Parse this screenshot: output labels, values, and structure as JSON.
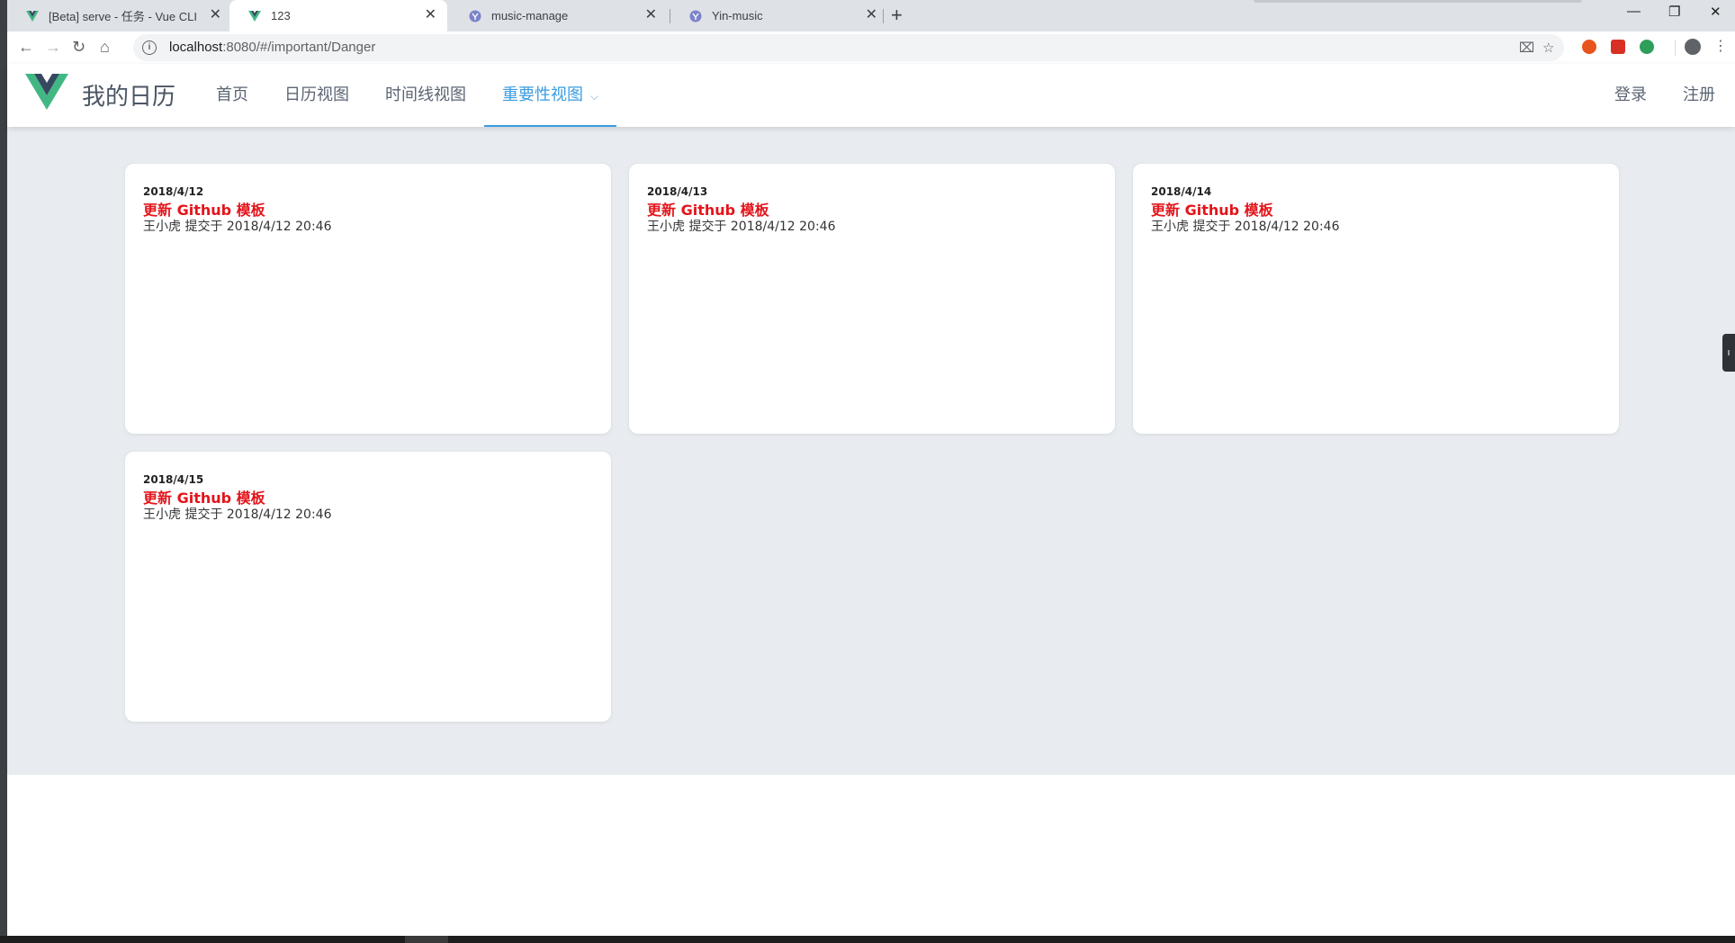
{
  "browser": {
    "tabs": [
      {
        "title": "[Beta] serve - 任务 - Vue CLI",
        "icon": "vue-icon",
        "active": false
      },
      {
        "title": "123",
        "icon": "vue-icon",
        "active": true
      },
      {
        "title": "music-manage",
        "icon": "yin-icon",
        "active": false
      },
      {
        "title": "Yin-music",
        "icon": "yin-icon",
        "active": false
      }
    ],
    "url_host": "localhost",
    "url_path": ":8080/#/important/Danger"
  },
  "app": {
    "brand": "我的日历",
    "nav": [
      {
        "label": "首页",
        "active": false
      },
      {
        "label": "日历视图",
        "active": false
      },
      {
        "label": "时间线视图",
        "active": false
      },
      {
        "label": "重要性视图",
        "active": true
      }
    ],
    "auth": {
      "login": "登录",
      "register": "注册"
    }
  },
  "cards": [
    {
      "date": "2018/4/12",
      "title": "更新 Github 模板",
      "meta": "王小虎 提交于 2018/4/12 20:46"
    },
    {
      "date": "2018/4/13",
      "title": "更新 Github 模板",
      "meta": "王小虎 提交于 2018/4/12 20:46"
    },
    {
      "date": "2018/4/14",
      "title": "更新 Github 模板",
      "meta": "王小虎 提交于 2018/4/12 20:46"
    },
    {
      "date": "2018/4/15",
      "title": "更新 Github 模板",
      "meta": "王小虎 提交于 2018/4/12 20:46"
    }
  ],
  "colors": {
    "accent": "#3a9de0",
    "danger_title": "#e3151b",
    "background": "#e8ecf0"
  }
}
